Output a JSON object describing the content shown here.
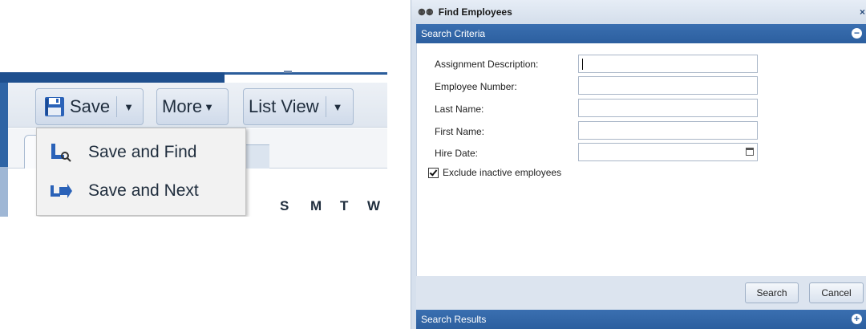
{
  "toolbar": {
    "save_label": "Save",
    "more_label": "More",
    "listview_label": "List View",
    "menu": [
      {
        "label": "Save and Find",
        "icon": "save-and-find-icon"
      },
      {
        "label": "Save and Next",
        "icon": "save-and-next-icon"
      }
    ],
    "days": [
      "S",
      "M",
      "T",
      "W"
    ]
  },
  "dialog": {
    "title": "Find Employees",
    "criteria_header": "Search Criteria",
    "results_header": "Search Results",
    "fields": [
      {
        "label": "Assignment Description:",
        "value": "",
        "placeholder": ""
      },
      {
        "label": "Employee Number:",
        "value": "",
        "placeholder": ""
      },
      {
        "label": "Last Name:",
        "value": "",
        "placeholder": ""
      },
      {
        "label": "First Name:",
        "value": "",
        "placeholder": ""
      },
      {
        "label": "Hire Date:",
        "value": "",
        "placeholder": ""
      }
    ],
    "exclude_inactive_label": "Exclude inactive employees",
    "exclude_inactive_checked": true,
    "search_label": "Search",
    "cancel_label": "Cancel"
  },
  "colors": {
    "header_blue": "#2c5f9f",
    "toolbar_blue": "#1e4f8e",
    "dialog_bg": "#d6e0ed"
  }
}
